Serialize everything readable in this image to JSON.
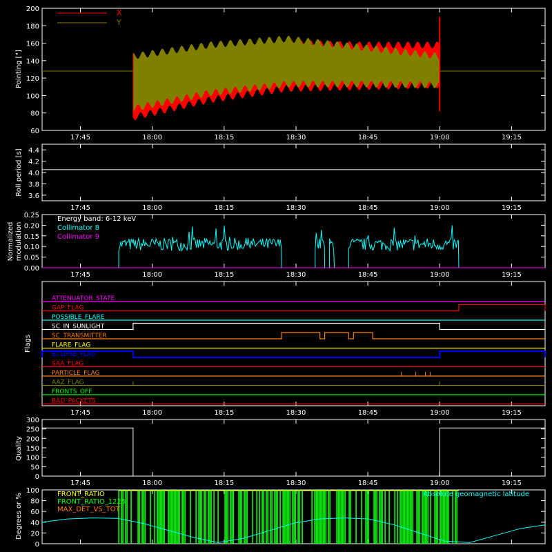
{
  "time_axis": {
    "ticks": [
      "17:45",
      "18:00",
      "18:15",
      "18:30",
      "18:45",
      "19:00",
      "19:15"
    ],
    "tick_minutes": [
      0,
      15,
      30,
      45,
      60,
      75,
      90
    ],
    "range_minutes": [
      -8,
      97
    ],
    "start_label": "17:37"
  },
  "colors": {
    "x_series": "#ff0000",
    "y_series": "#808000",
    "white": "#ffffff",
    "cyan": "#00ffff",
    "magenta": "#ff00ff",
    "green": "#00ff00",
    "yellow": "#ffff00",
    "orange": "#ff8000"
  },
  "chart_data": [
    {
      "type": "line",
      "ylabel": "Pointing [\"]",
      "ylim": [
        60,
        200
      ],
      "yticks": [
        60,
        80,
        100,
        120,
        140,
        160,
        180,
        200
      ],
      "legend": [
        {
          "name": "X",
          "color": "#ff0000"
        },
        {
          "name": "Y",
          "color": "#808000"
        }
      ],
      "series": [
        {
          "name": "X",
          "baseline": 128,
          "active_range": [
            "17:56",
            "19:00"
          ],
          "envelope_low": [
            75,
            95,
            108,
            110,
            112
          ],
          "envelope_high": [
            140,
            150,
            160,
            158,
            158
          ]
        },
        {
          "name": "Y",
          "baseline": 128,
          "active_range": [
            "17:56",
            "19:00"
          ],
          "envelope_low": [
            85,
            103,
            113,
            113,
            112
          ],
          "envelope_high": [
            145,
            158,
            165,
            155,
            145
          ]
        }
      ]
    },
    {
      "type": "line",
      "ylabel": "Roll period [s]",
      "ylim": [
        3.5,
        4.5
      ],
      "yticks": [
        3.6,
        3.8,
        4.0,
        4.2,
        4.4
      ],
      "series": [
        {
          "name": "",
          "values_const": 4.05
        }
      ]
    },
    {
      "type": "line",
      "ylabel": "Normalized modulation",
      "ylim": [
        0,
        0.25
      ],
      "yticks": [
        0.0,
        0.05,
        0.1,
        0.15,
        0.2,
        0.25
      ],
      "annotation": "Energy band: 6-12 keV",
      "legend": [
        {
          "name": "Collimator 8",
          "color": "#00ffff"
        },
        {
          "name": "Collimator 9",
          "color": "#ff00ff"
        }
      ],
      "series": [
        {
          "name": "Collimator 8",
          "segments": [
            [
              "17:53",
              "18:27"
            ],
            [
              "18:34",
              "18:36"
            ],
            [
              "18:37",
              "18:38"
            ],
            [
              "18:41",
              "19:04"
            ]
          ],
          "level": 0.11
        },
        {
          "name": "Collimator 9",
          "level": 0.0
        }
      ]
    },
    {
      "type": "line",
      "ylabel": "Flags",
      "flags": [
        {
          "name": "ATTENUATOR_STATE",
          "color": "#ff00ff",
          "highs": []
        },
        {
          "name": "GAP_FLAG",
          "color": "#ff0000",
          "highs": [
            [
              "19:04",
              "19:22"
            ]
          ]
        },
        {
          "name": "POSSIBLE_FLARE",
          "color": "#00ffff",
          "highs": []
        },
        {
          "name": "SC_IN_SUNLIGHT",
          "color": "#ffffff",
          "highs": [
            [
              "17:56",
              "19:00"
            ]
          ]
        },
        {
          "name": "SC_TRANSMITTER",
          "color": "#ff8000",
          "highs": [
            [
              "18:27",
              "18:35"
            ],
            [
              "18:36",
              "18:41"
            ],
            [
              "18:42",
              "18:46"
            ]
          ]
        },
        {
          "name": "FLARE_FLAG",
          "color": "#ffff00",
          "highs": []
        },
        {
          "name": "ECLIPSE_FLAG",
          "color": "#0000ff",
          "highs": [
            [
              "17:37",
              "17:56"
            ],
            [
              "19:00",
              "19:22"
            ]
          ]
        },
        {
          "name": "SAA_FLAG",
          "color": "#ff0000",
          "highs": []
        },
        {
          "name": "PARTICLE_FLAG",
          "color": "#ff8000",
          "spikes": [
            "18:52",
            "18:55",
            "18:57",
            "18:58"
          ]
        },
        {
          "name": "AAZ_FLAG",
          "color": "#808000",
          "spikes": [
            "17:56",
            "19:00"
          ]
        },
        {
          "name": "FRONTS_OFF",
          "color": "#00ff00",
          "highs": []
        },
        {
          "name": "BAD_PACKETS",
          "color": "#ff0000",
          "highs": []
        }
      ]
    },
    {
      "type": "line",
      "ylabel": "Quality",
      "ylim": [
        0,
        300
      ],
      "yticks": [
        0,
        50,
        100,
        150,
        200,
        250,
        300
      ],
      "series": [
        {
          "name": "",
          "steps": [
            [
              "17:37",
              255
            ],
            [
              "17:56",
              0
            ],
            [
              "19:00",
              255
            ]
          ]
        }
      ]
    },
    {
      "type": "area",
      "ylabel": "Degrees or %",
      "ylim": [
        0,
        100
      ],
      "yticks": [
        0,
        20,
        40,
        60,
        80,
        100
      ],
      "legend": [
        {
          "name": "FRONT_RATIO",
          "color": "#ffff00"
        },
        {
          "name": "FRONT_RATIO_1225",
          "color": "#00ff00"
        },
        {
          "name": "MAX_DET_VS_TOT",
          "color": "#ff8000"
        }
      ],
      "right_label": "Absolute geomagnetic latitude",
      "right_label_color": "#00ffff",
      "series": [
        {
          "name": "Absolute geomagnetic latitude",
          "values": [
            40,
            46,
            48,
            47,
            38,
            25,
            12,
            2,
            10,
            24,
            38,
            46,
            48,
            46,
            35,
            20,
            5,
            2,
            15,
            28,
            35
          ]
        },
        {
          "name": "FRONT_RATIO_1225",
          "active_range": [
            "17:53",
            "19:04"
          ],
          "level": 100
        }
      ]
    }
  ]
}
